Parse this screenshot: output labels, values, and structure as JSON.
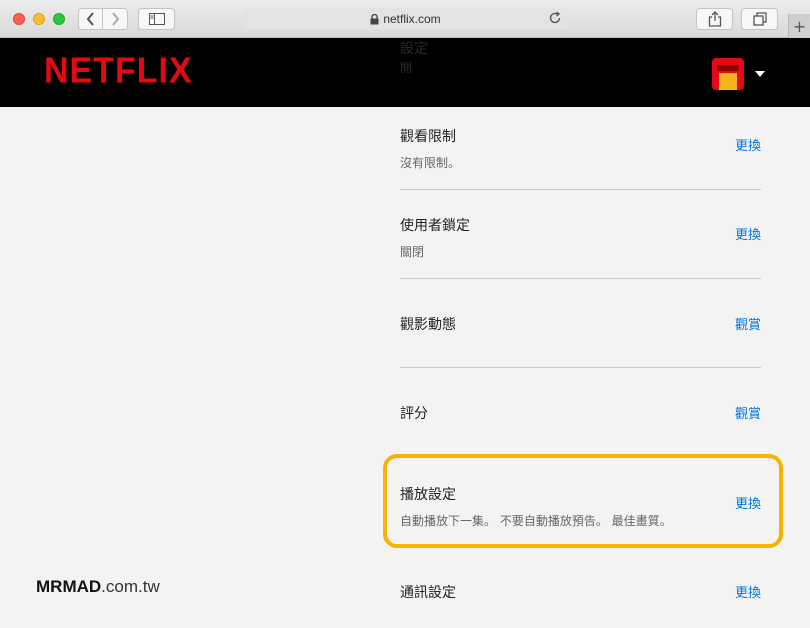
{
  "browser": {
    "url": "netflix.com",
    "new_tab_symbol": "+"
  },
  "header": {
    "logo": "NETFLIX",
    "ghost_line1": "設定",
    "ghost_line2": "開"
  },
  "settings": [
    {
      "title": "觀看限制",
      "subtitle": "沒有限制。",
      "action": "更換"
    },
    {
      "title": "使用者鎖定",
      "subtitle": "關閉",
      "action": "更換"
    },
    {
      "title": "觀影動態",
      "subtitle": "",
      "action": "觀賞"
    },
    {
      "title": "評分",
      "subtitle": "",
      "action": "觀賞"
    },
    {
      "title": "播放設定",
      "subtitle": "自動播放下一集。 不要自動播放預告。 最佳畫質。",
      "action": "更換"
    },
    {
      "title": "通訊設定",
      "subtitle": "",
      "action": "更換"
    }
  ],
  "watermark": {
    "brand": "MRMAD",
    "domain": ".com.tw"
  },
  "colors": {
    "netflix_red": "#e50914",
    "link_blue": "#0073e6",
    "highlight": "#f4b400"
  }
}
